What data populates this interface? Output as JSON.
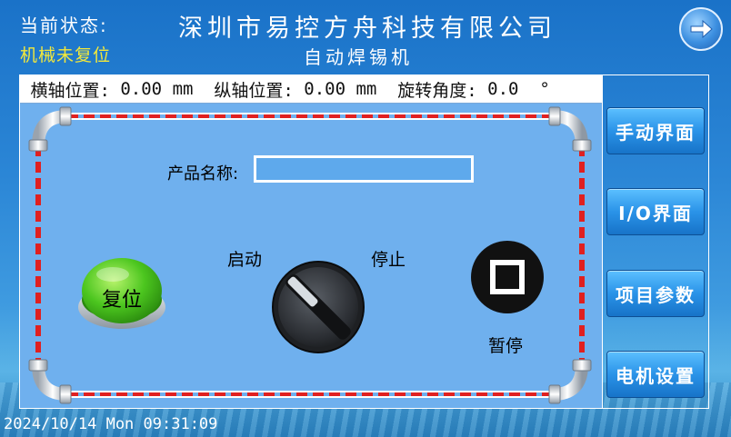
{
  "header": {
    "status_label": "当前状态:",
    "status_value": "机械未复位",
    "company": "深圳市易控方舟科技有限公司",
    "machine": "自动焊锡机"
  },
  "position_bar": {
    "x_label": "横轴位置:",
    "x_value": "0.00",
    "x_unit": "mm",
    "y_label": "纵轴位置:",
    "y_value": "0.00",
    "y_unit": "mm",
    "rot_label": "旋转角度:",
    "rot_value": "0.0",
    "rot_unit": "°"
  },
  "main": {
    "product_label": "产品名称:",
    "product_value": "",
    "start_label": "启动",
    "stop_label": "停止",
    "pause_label": "暂停",
    "reset_label": "复位"
  },
  "side_menu": [
    {
      "label": "手动界面"
    },
    {
      "label": "I/O界面"
    },
    {
      "label": "项目参数"
    },
    {
      "label": "电机设置"
    }
  ],
  "footer": {
    "datetime": "2024/10/14 Mon 09:31:09"
  },
  "icons": {
    "next": "arrow-right-icon",
    "pause": "stop-square-icon"
  },
  "colors": {
    "status_value": "#f3e83a",
    "panel": "#6fb0ee",
    "pipe_stripe": "#e02020",
    "reset_button": "#3fbf1f",
    "side_button": "#2a93e8"
  }
}
